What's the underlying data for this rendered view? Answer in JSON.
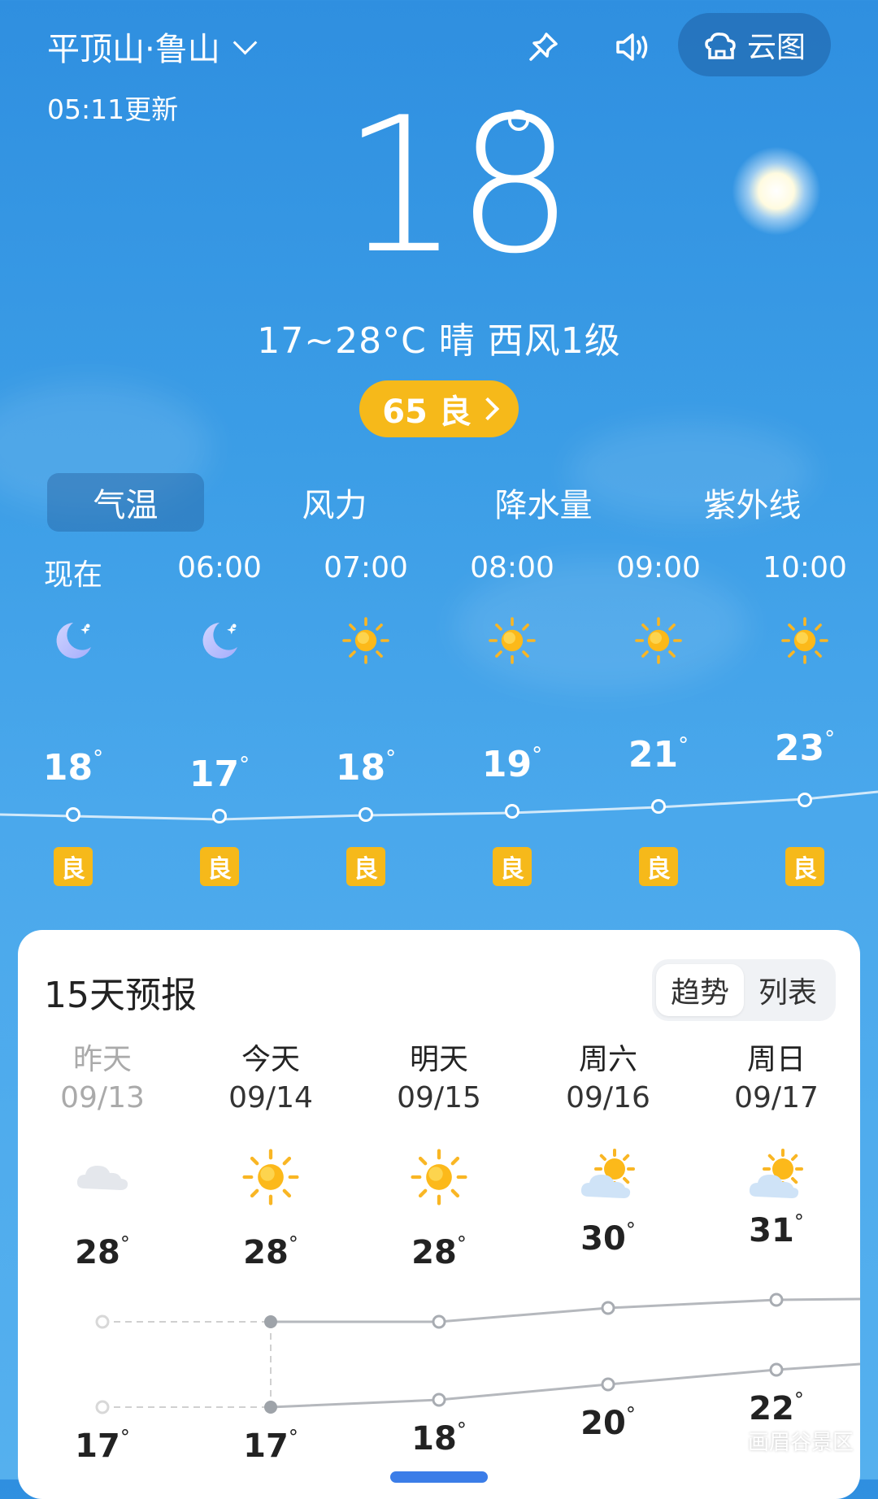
{
  "header": {
    "location": "平顶山·鲁山",
    "update_time": "05:11更新",
    "cloud_map_label": "云图"
  },
  "current": {
    "temperature": "18",
    "summary": "17~28°C 晴 西风1级",
    "aqi_label": "65 良"
  },
  "tabs": [
    {
      "label": "气温",
      "active": true
    },
    {
      "label": "风力",
      "active": false
    },
    {
      "label": "降水量",
      "active": false
    },
    {
      "label": "紫外线",
      "active": false
    }
  ],
  "hourly": [
    {
      "time": "现在",
      "icon": "moon-icon",
      "temp": "18",
      "aqi": "良"
    },
    {
      "time": "06:00",
      "icon": "moon-icon",
      "temp": "17",
      "aqi": "良"
    },
    {
      "time": "07:00",
      "icon": "sun-icon",
      "temp": "18",
      "aqi": "良"
    },
    {
      "time": "08:00",
      "icon": "sun-icon",
      "temp": "19",
      "aqi": "良"
    },
    {
      "time": "09:00",
      "icon": "sun-icon",
      "temp": "21",
      "aqi": "良"
    },
    {
      "time": "10:00",
      "icon": "sun-icon",
      "temp": "23",
      "aqi": "良"
    }
  ],
  "forecast": {
    "title": "15天预报",
    "view_options": [
      "趋势",
      "列表"
    ],
    "days": [
      {
        "name": "昨天",
        "date": "09/13",
        "icon": "cloudy-icon",
        "high": "28",
        "low": "17"
      },
      {
        "name": "今天",
        "date": "09/14",
        "icon": "sun-icon",
        "high": "28",
        "low": "17"
      },
      {
        "name": "明天",
        "date": "09/15",
        "icon": "sun-icon",
        "high": "28",
        "low": "18"
      },
      {
        "name": "周六",
        "date": "09/16",
        "icon": "partly-cloudy-icon",
        "high": "30",
        "low": "20"
      },
      {
        "name": "周日",
        "date": "09/17",
        "icon": "partly-cloudy-icon",
        "high": "31",
        "low": "22"
      }
    ]
  },
  "watermark": "画眉谷景区",
  "colors": {
    "aqi_good": "#f6b91a",
    "sky_top": "#2f8fe0",
    "sky_bottom": "#55b0ee"
  }
}
